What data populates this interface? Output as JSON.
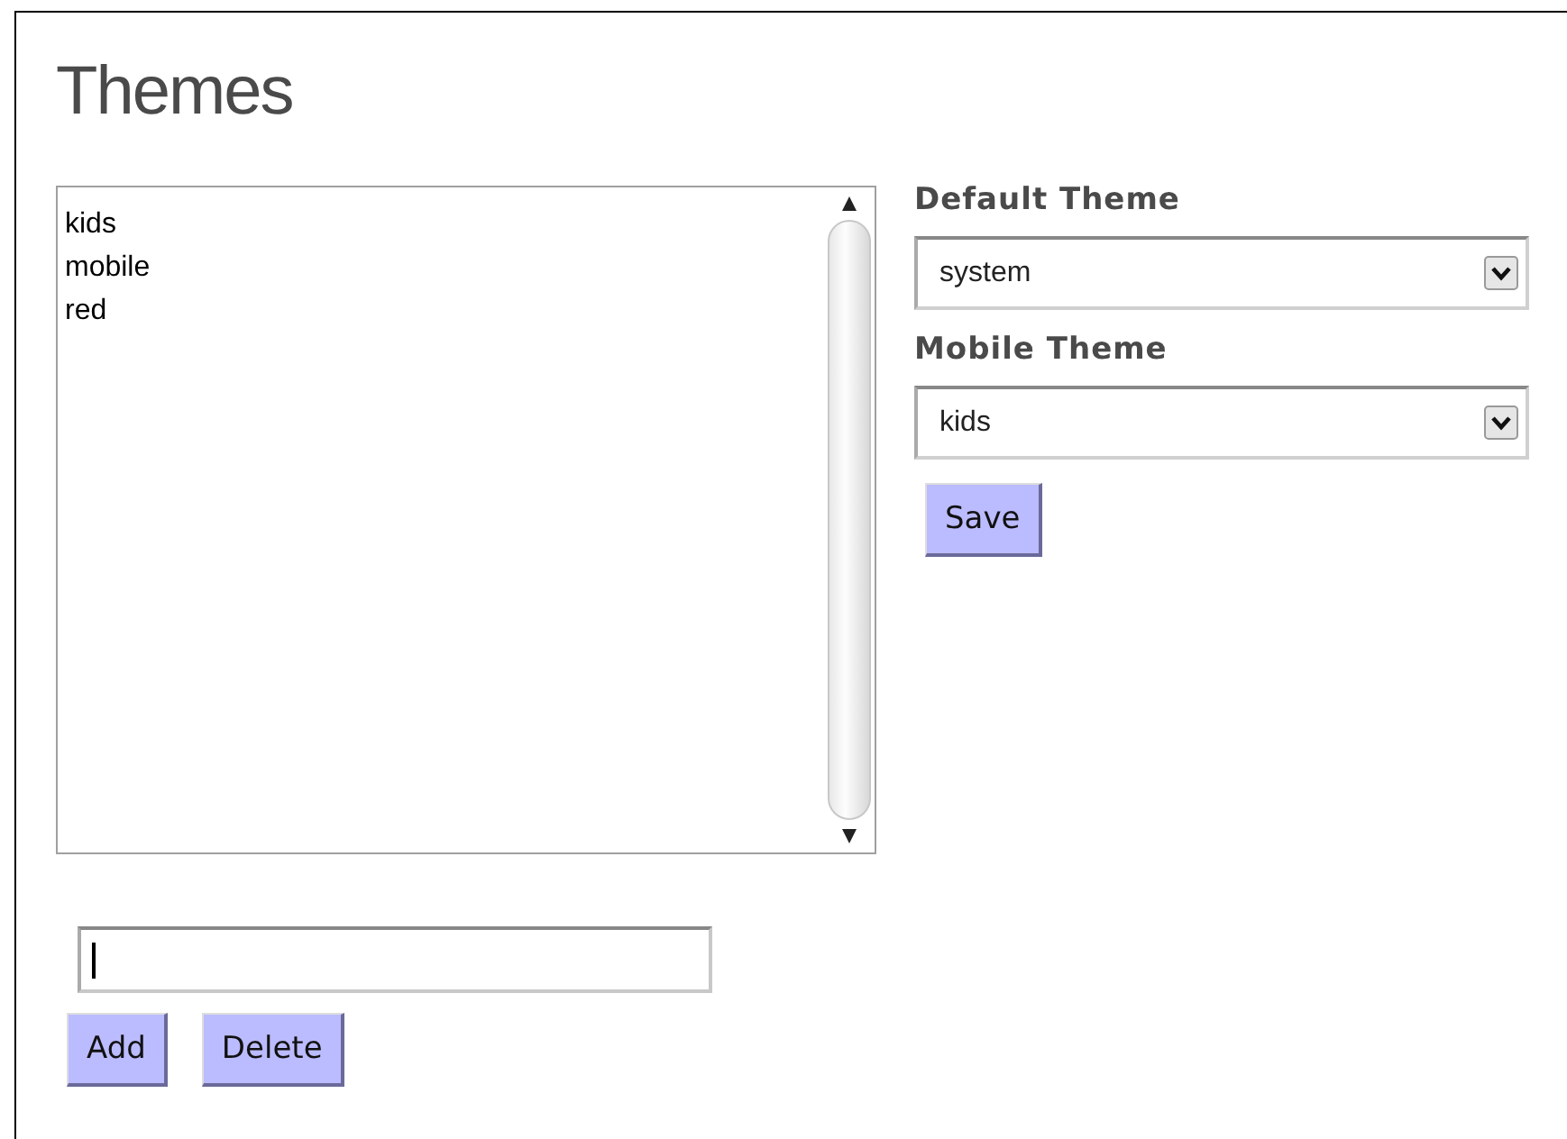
{
  "title": "Themes",
  "themes": [
    {
      "label": "kids",
      "selected": false
    },
    {
      "label": "mobile",
      "selected": false
    },
    {
      "label": "red",
      "selected": false
    }
  ],
  "new_theme": {
    "focused": true
  },
  "list_buttons": [
    "Add",
    "Delete"
  ],
  "settings": [
    {
      "label": "Default Theme",
      "value": "system"
    },
    {
      "label": "Mobile Theme",
      "value": "kids"
    }
  ],
  "save_button": "Save"
}
